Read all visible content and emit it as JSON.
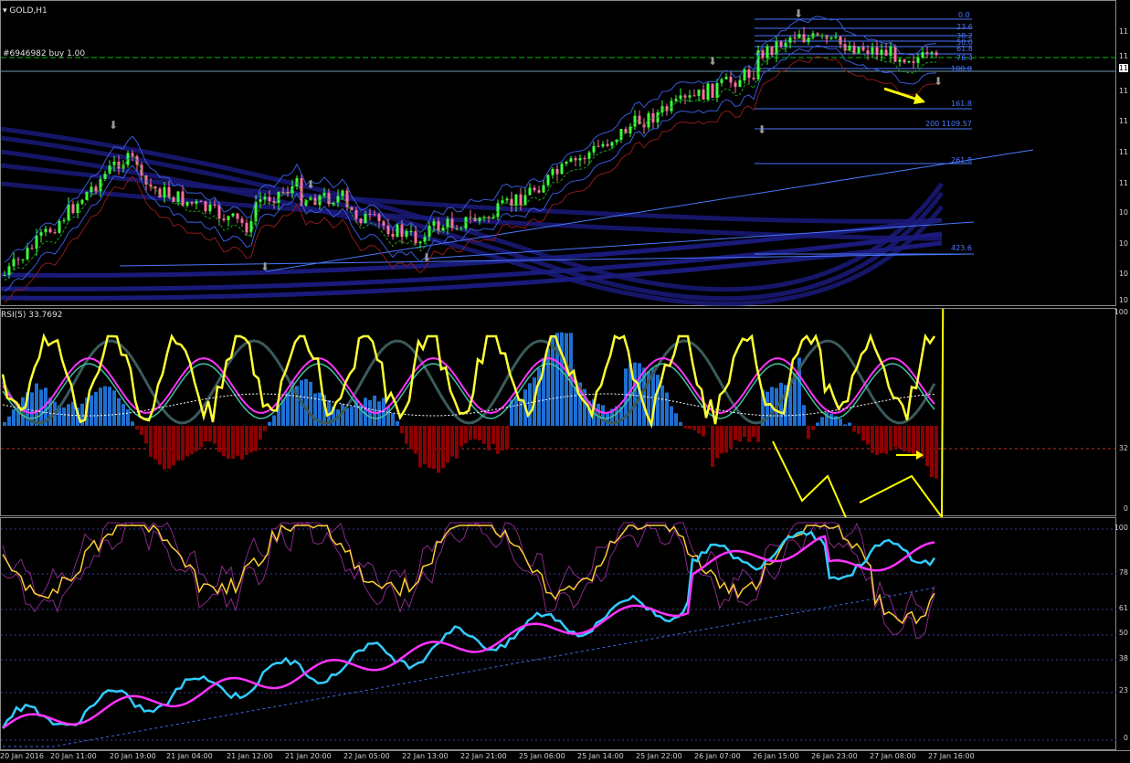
{
  "main": {
    "symbol_title": "GOLD,H1",
    "order_label": "#6946982 buy 1.00",
    "price_axis": [
      "11",
      "11",
      "11",
      "11",
      "11",
      "11",
      "11",
      "10",
      "10",
      "10",
      "10",
      "10"
    ],
    "price_tag": "11",
    "fib_levels": [
      "0.0",
      "23.6",
      "38.2",
      "50.0",
      "61.8",
      "76.4",
      "100.0",
      "161.8",
      "200 1109.57",
      "261.8",
      "423.6"
    ],
    "colors": {
      "bull": "#3cff3c",
      "bear": "#ff6fa0",
      "band": "#1a1a7a",
      "trend": "#4a78ff"
    }
  },
  "rsi": {
    "title": "RSI(5) 33.7692",
    "axis": [
      "100",
      "32",
      "0"
    ],
    "colors": {
      "pos": "#1f6fd0",
      "neg": "#8b0000",
      "line": "#ffff33",
      "avg": "#ff33ff"
    }
  },
  "osc": {
    "axis": [
      "100",
      "78",
      "61",
      "50",
      "38",
      "23",
      "0"
    ],
    "colors": {
      "fast": "#33ccff",
      "slow": "#ff33ff",
      "gold": "#ffcc33"
    }
  },
  "time_axis": [
    "20 Jan 2016",
    "20 Jan 11:00",
    "20 Jan 19:00",
    "21 Jan 04:00",
    "21 Jan 12:00",
    "21 Jan 20:00",
    "22 Jan 05:00",
    "22 Jan 13:00",
    "22 Jan 21:00",
    "25 Jan 06:00",
    "25 Jan 14:00",
    "25 Jan 22:00",
    "26 Jan 07:00",
    "26 Jan 15:00",
    "26 Jan 23:00",
    "27 Jan 08:00",
    "27 Jan 16:00"
  ]
}
